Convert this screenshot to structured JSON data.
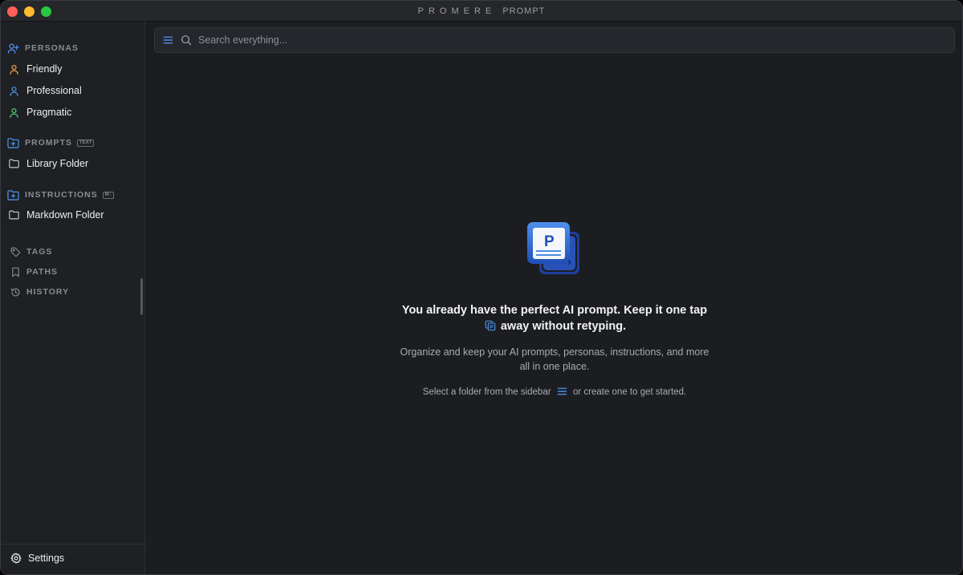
{
  "window": {
    "title_brand": "PROMERE",
    "title_word": "PROMPT"
  },
  "colors": {
    "accent": "#4a8fe2",
    "persona_friendly": "#f0a04b",
    "persona_professional": "#4a8fe2",
    "persona_pragmatic": "#4fc774",
    "background": "#1c1d21",
    "sidebar": "#1f2024"
  },
  "sidebar": {
    "personas": {
      "heading": "PERSONAS",
      "icon": "user-plus-icon",
      "items": [
        {
          "label": "Friendly",
          "icon": "user-icon"
        },
        {
          "label": "Professional",
          "icon": "user-icon"
        },
        {
          "label": "Pragmatic",
          "icon": "user-icon"
        }
      ]
    },
    "prompts": {
      "heading": "PROMPTS",
      "badge": "TEXT",
      "icon": "folder-plus-icon",
      "items": [
        {
          "label": "Library Folder",
          "icon": "folder-icon"
        }
      ]
    },
    "instructions": {
      "heading": "INSTRUCTIONS",
      "badge": "M↓",
      "icon": "folder-plus-icon",
      "items": [
        {
          "label": "Markdown Folder",
          "icon": "folder-icon"
        }
      ]
    },
    "tags": {
      "label": "TAGS",
      "icon": "tag-icon"
    },
    "paths": {
      "label": "PATHS",
      "icon": "bookmark-icon"
    },
    "history": {
      "label": "HISTORY",
      "icon": "history-icon"
    },
    "settings": {
      "label": "Settings",
      "icon": "gear-icon"
    }
  },
  "search": {
    "placeholder": "Search everything..."
  },
  "empty_state": {
    "logo_letter": "P",
    "headline_part1": "You already have the perfect AI prompt. Keep it one tap",
    "headline_part2": "away without retyping.",
    "subtitle": "Organize and keep your AI prompts, personas, instructions, and more all in one place.",
    "hint_part1": "Select a folder from the sidebar",
    "hint_part2": "or create one to get started."
  }
}
